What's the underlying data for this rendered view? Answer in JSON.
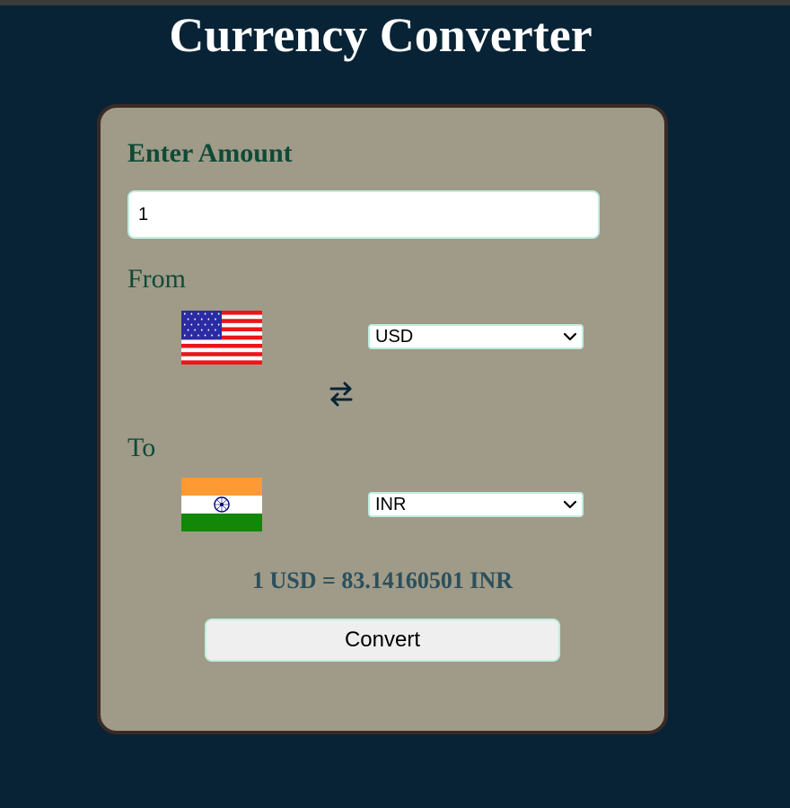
{
  "app": {
    "title": "Currency Converter"
  },
  "amount": {
    "label": "Enter Amount",
    "value": "1"
  },
  "from": {
    "label": "From",
    "currency": "USD",
    "flag_icon": "us-flag-icon"
  },
  "to": {
    "label": "To",
    "currency": "INR",
    "flag_icon": "india-flag-icon"
  },
  "swap": {
    "icon": "swap-arrows-icon",
    "glyph": "⇄"
  },
  "result": {
    "text": "1 USD = 83.14160501 INR"
  },
  "convert": {
    "label": "Convert"
  },
  "colors": {
    "background": "#082335",
    "card": "#9f9b88",
    "card_border": "#3a2a25",
    "label_green": "#0f4a37",
    "result_text": "#2c4f5c",
    "input_border": "#bfeee0"
  }
}
